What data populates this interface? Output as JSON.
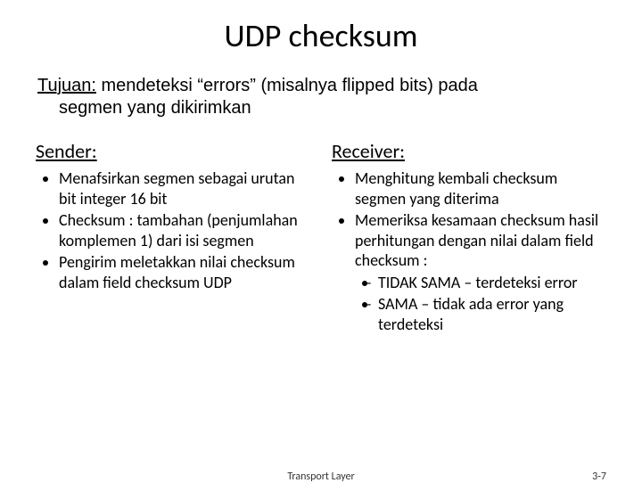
{
  "title": "UDP checksum",
  "goal": {
    "label": "Tujuan:",
    "text_line1": " mendeteksi “errors” (misalnya flipped bits) pada",
    "text_line2": "segmen yang dikirimkan"
  },
  "sender": {
    "heading": "Sender:",
    "items": [
      "Menafsirkan segmen sebagai urutan bit integer 16 bit",
      "Checksum : tambahan (penjumlahan komplemen 1) dari isi segmen",
      "Pengirim meletakkan nilai checksum dalam field checksum UDP"
    ]
  },
  "receiver": {
    "heading": "Receiver:",
    "items": [
      {
        "text": "Menghitung kembali checksum segmen yang diterima"
      },
      {
        "text": "Memeriksa kesamaan checksum hasil perhitungan dengan nilai dalam field checksum :",
        "sub": [
          "TIDAK SAMA – terdeteksi error",
          "SAMA – tidak ada error yang terdeteksi"
        ]
      }
    ]
  },
  "footer": {
    "label": "Transport Layer",
    "page": "3-7"
  }
}
